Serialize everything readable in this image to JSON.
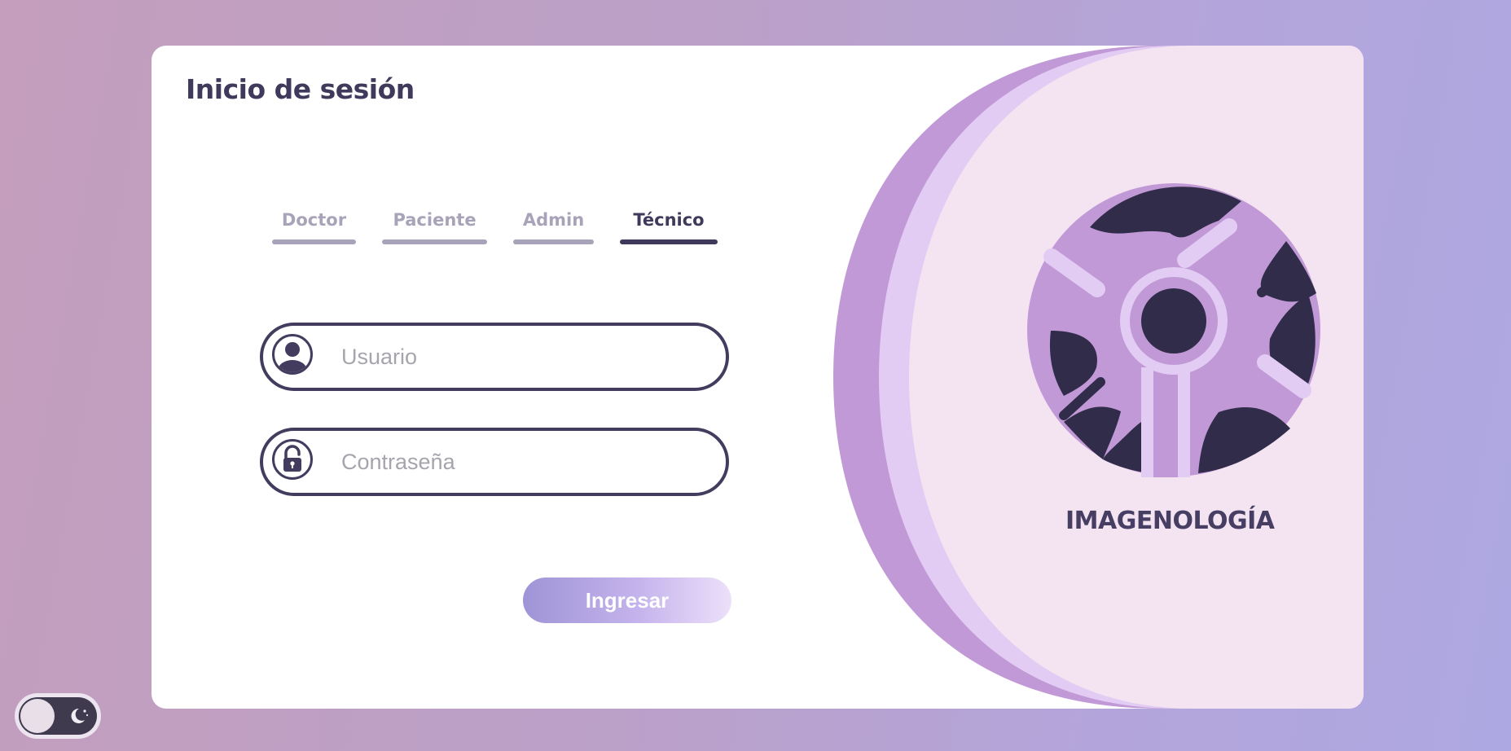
{
  "login": {
    "title": "Inicio de sesión",
    "tabs": [
      {
        "label": "Doctor",
        "active": false
      },
      {
        "label": "Paciente",
        "active": false
      },
      {
        "label": "Admin",
        "active": false
      },
      {
        "label": "Técnico",
        "active": true
      }
    ],
    "username": {
      "placeholder": "Usuario",
      "icon": "user-icon"
    },
    "password": {
      "placeholder": "Contraseña",
      "icon": "lock-icon"
    },
    "submit_label": "Ingresar"
  },
  "brand": {
    "name": "IMAGENOLOGÍA",
    "logo_icon": "aperture-wheel-logo"
  },
  "theme_toggle": {
    "icon_on": "moon-stars-icon",
    "dark_mode": false
  },
  "colors": {
    "primary": "#3f3a5c",
    "muted": "#a8a3b8",
    "accent_light": "#f4e4f2",
    "accent_mid": "#c199d6",
    "accent_pale": "#e2ccf3"
  }
}
